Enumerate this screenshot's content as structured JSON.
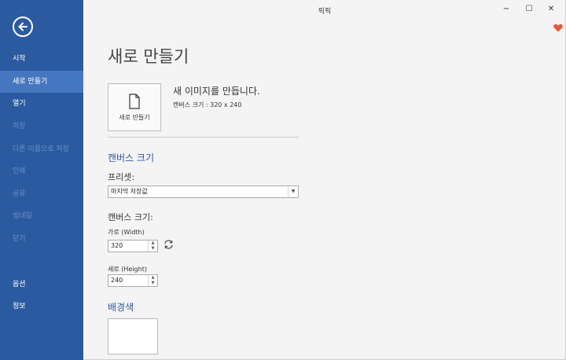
{
  "window": {
    "title": "픽픽",
    "controls": {
      "minimize": "−",
      "maximize": "☐",
      "close": "✕"
    }
  },
  "sidebar": {
    "items": [
      {
        "label": "시작",
        "state": "normal"
      },
      {
        "label": "새로 만들기",
        "state": "active"
      },
      {
        "label": "열기",
        "state": "normal"
      },
      {
        "label": "저장",
        "state": "disabled"
      },
      {
        "label": "다른 이름으로 저장",
        "state": "disabled"
      },
      {
        "label": "인쇄",
        "state": "disabled"
      },
      {
        "label": "공유",
        "state": "disabled"
      },
      {
        "label": "썸네일",
        "state": "disabled"
      },
      {
        "label": "닫기",
        "state": "disabled"
      },
      {
        "label": "옵션",
        "state": "normal"
      },
      {
        "label": "정보",
        "state": "normal"
      }
    ]
  },
  "main": {
    "page_title": "새로 만들기",
    "new_tile_label": "새로 만들기",
    "new_desc_title": "새 이미지를 만듭니다.",
    "new_desc_sub": "캔버스 크기 : 320 x 240",
    "canvas_section_title": "캔버스 크기",
    "preset_label": "프리셋:",
    "preset_value": "마지막 저장값",
    "canvas_size_label": "캔버스 크기:",
    "width_label": "가로 (Width)",
    "width_value": "320",
    "height_label": "세로 (Height)",
    "height_value": "240",
    "bg_section_title": "배경색",
    "bg_color": "#ffffff"
  },
  "colors": {
    "sidebar": "#2c5aa0",
    "sidebar_active": "#4577c0",
    "accent": "#2b579a",
    "heart": "#e05a3a"
  },
  "icons": {
    "back": "back-arrow-icon",
    "new": "new-document-icon",
    "swap": "swap-dimensions-icon",
    "heart": "heart-icon"
  }
}
